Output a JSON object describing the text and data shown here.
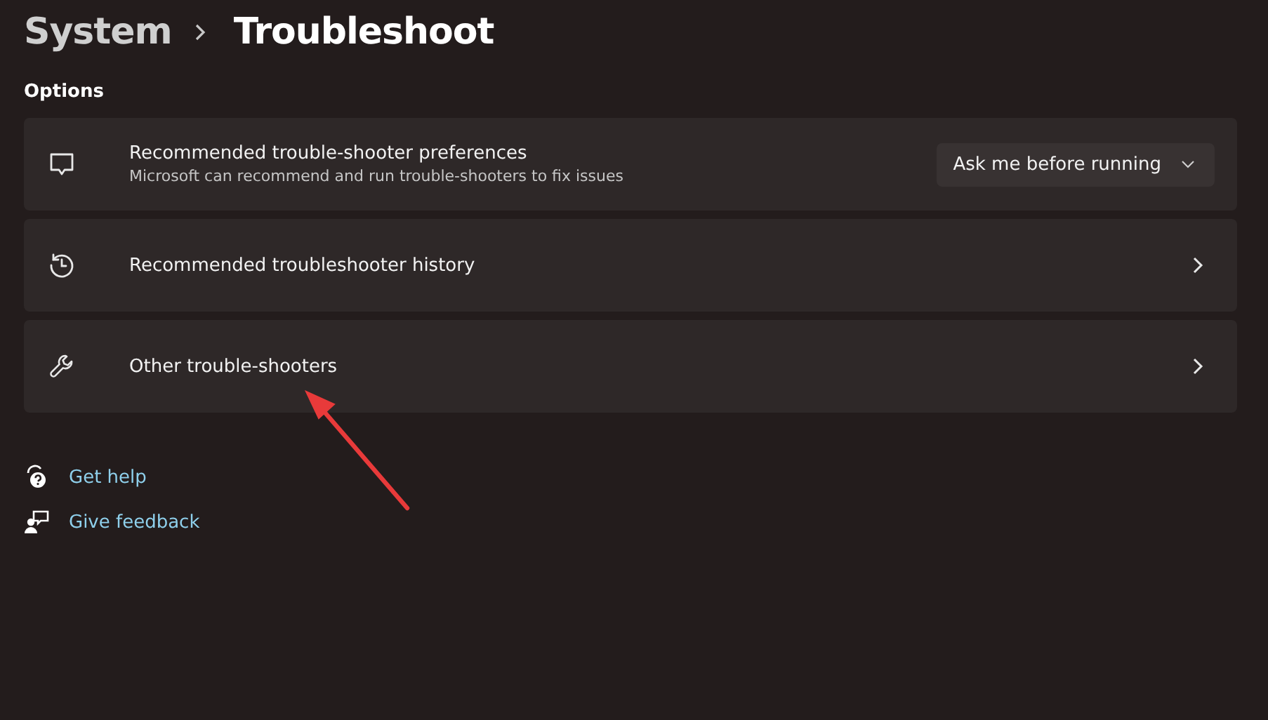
{
  "breadcrumb": {
    "parent": "System",
    "current": "Troubleshoot"
  },
  "section_title": "Options",
  "cards": [
    {
      "kind": "dropdown",
      "title": "Recommended trouble-shooter preferences",
      "description": "Microsoft can recommend and run trouble-shooters to fix issues",
      "value": "Ask me before running"
    },
    {
      "kind": "link",
      "title": "Recommended troubleshooter history"
    },
    {
      "kind": "link",
      "title": "Other trouble-shooters"
    }
  ],
  "links": [
    "Get help",
    "Give feedback"
  ]
}
